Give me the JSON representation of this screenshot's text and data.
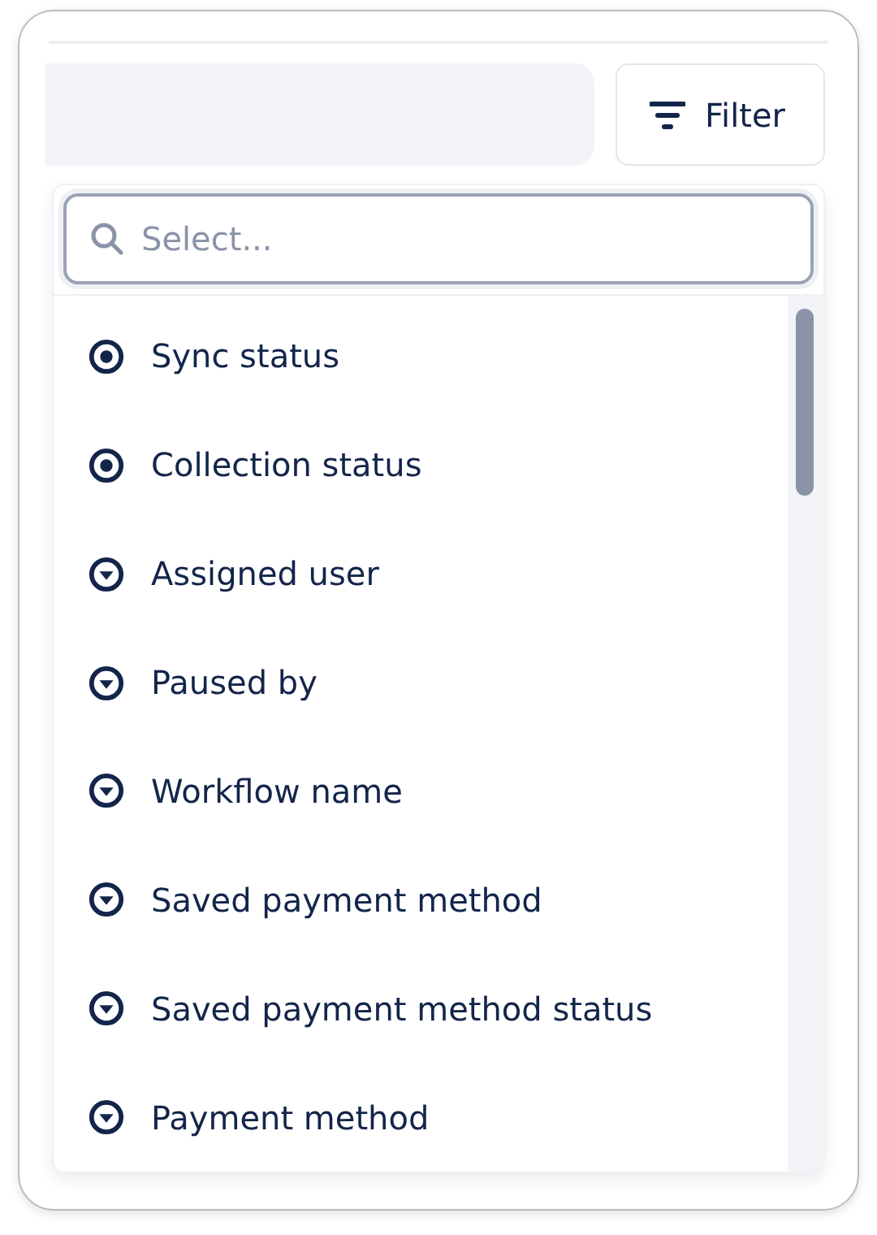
{
  "filter_button": {
    "label": "Filter"
  },
  "dropdown": {
    "search": {
      "placeholder": "Select..."
    },
    "options": [
      {
        "label": "Sync status",
        "kind": "status"
      },
      {
        "label": "Collection status",
        "kind": "status"
      },
      {
        "label": "Assigned user",
        "kind": "select"
      },
      {
        "label": "Paused by",
        "kind": "select"
      },
      {
        "label": "Workflow name",
        "kind": "select"
      },
      {
        "label": "Saved payment method",
        "kind": "select"
      },
      {
        "label": "Saved payment method status",
        "kind": "select"
      },
      {
        "label": "Payment method",
        "kind": "select"
      }
    ]
  }
}
